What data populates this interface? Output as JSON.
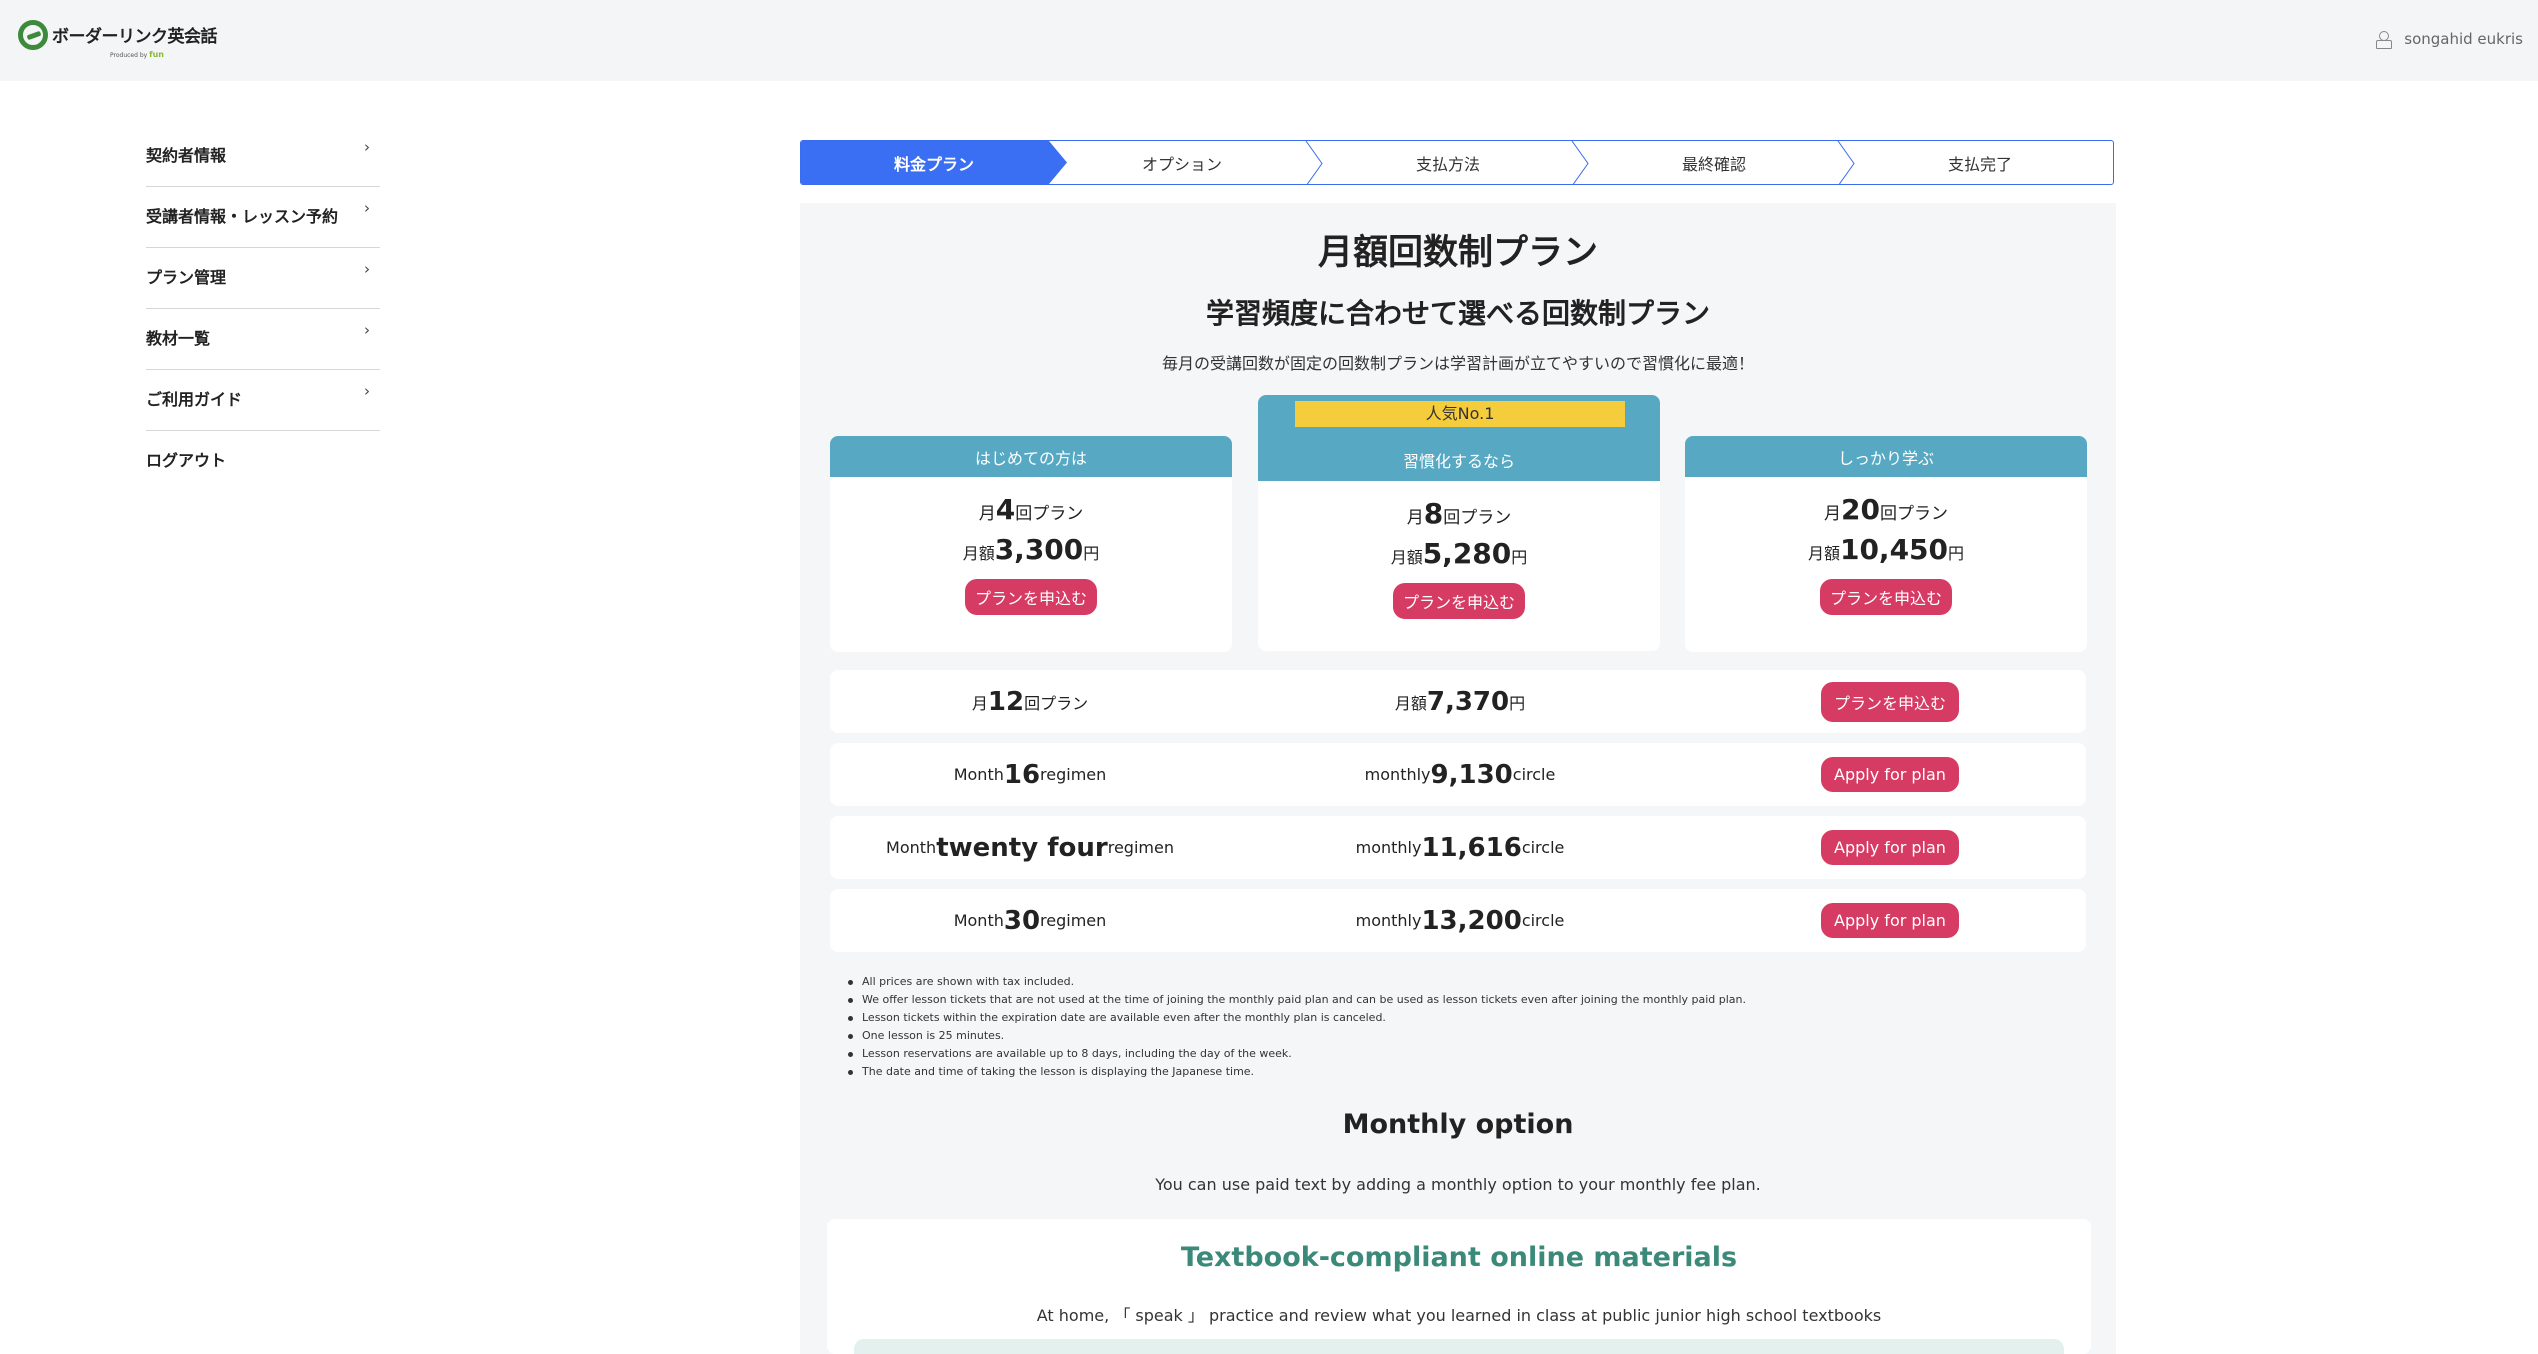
{
  "header": {
    "logo": "ボーダーリンク英会話",
    "logo_sub": "Produced by",
    "logo_brand": "fun",
    "user_name": "songahid eukris"
  },
  "sidebar": {
    "items": [
      {
        "label": "契約者情報",
        "chevron": "›"
      },
      {
        "label": "受講者情報・レッスン予約",
        "chevron": "›"
      },
      {
        "label": "プラン管理",
        "chevron": "›"
      },
      {
        "label": "教材一覧",
        "chevron": "›"
      },
      {
        "label": "ご利用ガイド",
        "chevron": "›"
      },
      {
        "label": "ログアウト",
        "chevron": ""
      }
    ]
  },
  "steps": [
    "料金プラン",
    "オプション",
    "支払方法",
    "最終確認",
    "支払完了"
  ],
  "active_step": "料金プラン",
  "plans": {
    "title": "月額回数制プラン",
    "subtitle": "学習頻度に合わせて選べる回数制プラン",
    "description": "毎月の受講回数が固定の回数制プランは学習計画が立てやすいので習慣化に最適！",
    "cards": [
      {
        "header": "はじめての方は",
        "pre1": "月",
        "count": "4",
        "post1": "回プラン",
        "pre2": "月額",
        "price": "3,300",
        "post2": "円",
        "button": "プランを申込む"
      },
      {
        "ribbon": "人気No.1",
        "header": "習慣化するなら",
        "pre1": "月",
        "count": "8",
        "post1": "回プラン",
        "pre2": "月額",
        "price": "5,280",
        "post2": "円",
        "button": "プランを申込む"
      },
      {
        "header": "しっかり学ぶ",
        "pre1": "月",
        "count": "20",
        "post1": "回プラン",
        "pre2": "月額",
        "price": "10,450",
        "post2": "円",
        "button": "プランを申込む"
      }
    ],
    "rows": [
      {
        "pre1": "月 ",
        "count": "12",
        "post1": "回プラン",
        "pre2": "月額 ",
        "price": "7,370",
        "post2": "円",
        "button": "プランを申込む"
      },
      {
        "pre1": "Month ",
        "count": "16",
        "post1": "regimen",
        "pre2": "monthly ",
        "price": "9,130",
        "post2": "circle",
        "button": "Apply for plan"
      },
      {
        "pre1": "Month ",
        "count": "twenty four",
        "post1": "regimen",
        "pre2": "monthly ",
        "price": "11,616",
        "post2": "circle",
        "button": "Apply for plan"
      },
      {
        "pre1": "Month ",
        "count": "30",
        "post1": "regimen",
        "pre2": "monthly ",
        "price": "13,200",
        "post2": "circle",
        "button": "Apply for plan"
      }
    ],
    "notes": [
      "All prices are shown with tax included.",
      "We offer lesson tickets that are not used at the time of joining the monthly paid plan and can be used as lesson tickets even after joining the monthly paid plan.",
      "Lesson tickets within the expiration date are available even after the monthly plan is canceled.",
      "One lesson is 25 minutes.",
      "Lesson reservations are available up to 8 days, including the day of the week.",
      "The date and time of taking the lesson is displaying the Japanese time."
    ]
  },
  "monthly_option": {
    "title": "Monthly option",
    "description": "You can use paid text by adding a monthly option to your monthly fee plan.",
    "textbook_title": "Textbook-compliant online materials",
    "textbook_desc": "At home, 「 speak 」 practice and review what you learned in class at public junior high school textbooks"
  },
  "colors": {
    "accent": "#3b6ff3",
    "card_header": "#57a8c3",
    "apply_button": "#d63b63",
    "ribbon": "#f5cc3c",
    "textbook_title": "#3b8a79"
  }
}
